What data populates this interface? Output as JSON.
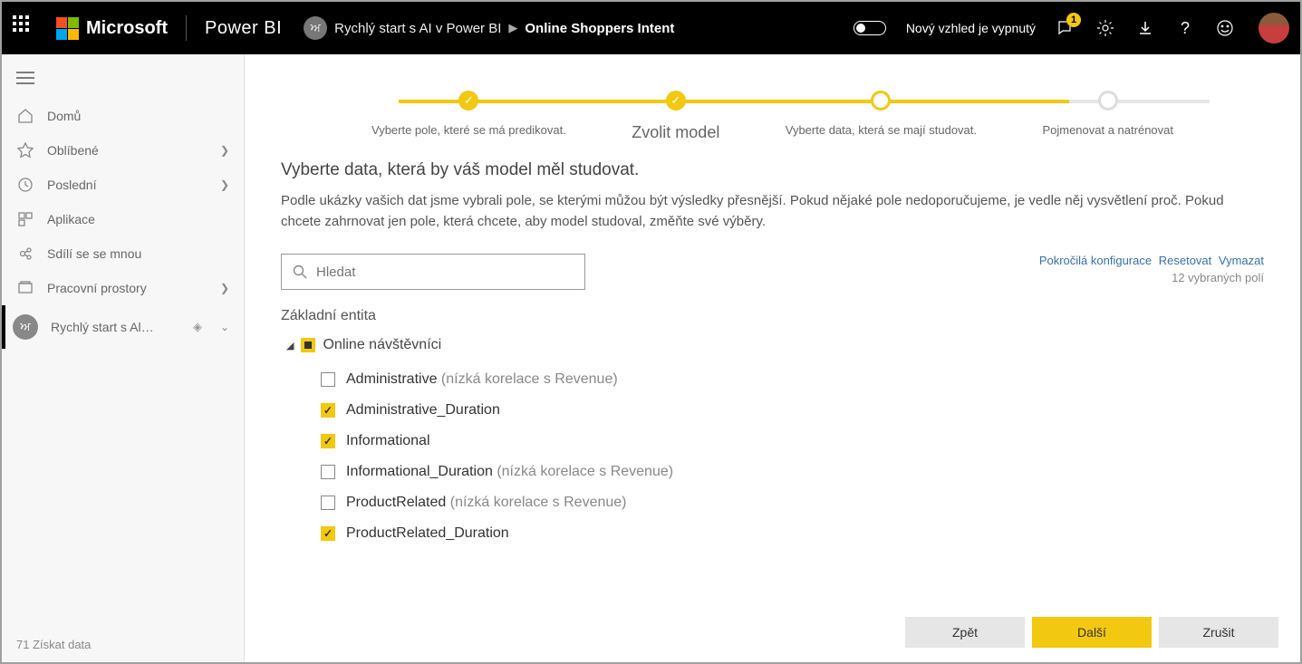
{
  "header": {
    "brand": "Microsoft",
    "product": "Power BI",
    "workspace_initials": "ਅ",
    "breadcrumb_ws": "Rychlý start s AI v Power BI",
    "breadcrumb_current": "Online Shoppers Intent",
    "toggle_label": "Nový vzhled je vypnutý",
    "notif_count": "1"
  },
  "sidebar": {
    "items": [
      {
        "icon": "home",
        "label": "Domů"
      },
      {
        "icon": "star",
        "label": "Oblíbené",
        "chev": true
      },
      {
        "icon": "clock",
        "label": "Poslední",
        "chev": true
      },
      {
        "icon": "apps",
        "label": "Aplikace"
      },
      {
        "icon": "share",
        "label": "Sdílí se se mnou"
      },
      {
        "icon": "workspace",
        "label": "Pracovní prostory",
        "chev": true
      }
    ],
    "active": {
      "label": "Rychlý start s Al…",
      "initials": "ਅ"
    },
    "footer_num": "71",
    "footer_label": "Získat data"
  },
  "stepper": {
    "steps": [
      {
        "label": "Vyberte pole, které se má predikovat.",
        "state": "done"
      },
      {
        "label": "Zvolit model",
        "state": "done",
        "current_label": true
      },
      {
        "label": "Vyberte data, která se mají studovat.",
        "state": "current"
      },
      {
        "label": "Pojmenovat a natrénovat",
        "state": "pending"
      }
    ]
  },
  "content": {
    "title": "Vyberte data, která by váš model měl studovat.",
    "desc": "Podle ukázky vašich dat jsme vybrali pole, se kterými můžou být výsledky přesnější. Pokud nějaké pole nedoporučujeme, je vedle něj vysvětlení proč. Pokud chcete zahrnovat jen pole, která chcete, aby model studoval, změňte své výběry.",
    "search_placeholder": "Hledat",
    "links": {
      "adv": "Pokročilá konfigurace",
      "reset": "Resetovat",
      "clear": "Vymazat"
    },
    "count": "12 vybraných polí",
    "entity_heading": "Základní entita",
    "root_label": "Online návštěvníci",
    "fields": [
      {
        "label": "Administrative",
        "hint": "(nízká korelace s Revenue)",
        "checked": false
      },
      {
        "label": "Administrative_Duration",
        "hint": "",
        "checked": true
      },
      {
        "label": "Informational",
        "hint": "",
        "checked": true
      },
      {
        "label": "Informational_Duration",
        "hint": "(nízká korelace s Revenue)",
        "checked": false
      },
      {
        "label": "ProductRelated",
        "hint": "(nízká korelace s Revenue)",
        "checked": false
      },
      {
        "label": "ProductRelated_Duration",
        "hint": "",
        "checked": true
      }
    ]
  },
  "footer": {
    "back": "Zpět",
    "next": "Další",
    "cancel": "Zrušit"
  }
}
